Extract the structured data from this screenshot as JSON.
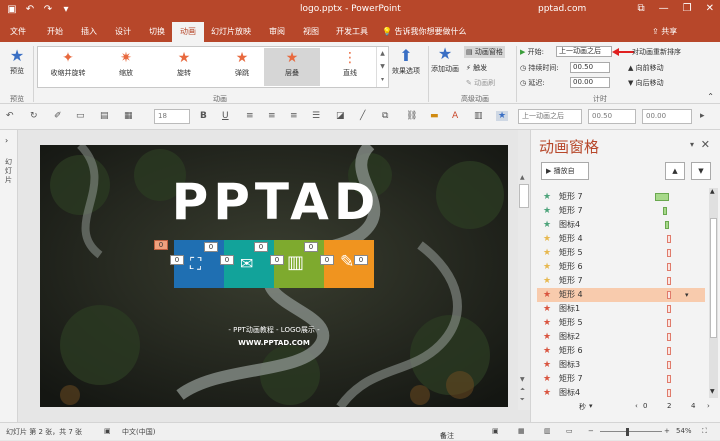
{
  "titlebar": {
    "doc_title": "logo.pptx  -  PowerPoint",
    "account": "pptad.com",
    "save_icon": "save-icon",
    "undo_icon": "undo-icon",
    "redo_icon": "redo-icon",
    "minimize": "—",
    "restore": "❐",
    "close": "✕",
    "ribbon_display": "⧉"
  },
  "tabs": [
    "文件",
    "开始",
    "插入",
    "设计",
    "切换",
    "动画",
    "幻灯片放映",
    "审阅",
    "视图",
    "开发工具"
  ],
  "active_tab": "动画",
  "tell_me": "告诉我你想要做什么",
  "share": "共享",
  "ribbon": {
    "preview": {
      "label": "预览",
      "group": "预览"
    },
    "gallery": [
      {
        "label": "收缩并旋转",
        "selected": false
      },
      {
        "label": "缩放",
        "selected": false
      },
      {
        "label": "旋转",
        "selected": false
      },
      {
        "label": "弹跳",
        "selected": false
      },
      {
        "label": "层叠",
        "selected": true
      },
      {
        "label": "直线",
        "selected": false
      }
    ],
    "effect_options": "效果选项",
    "animation_group": "动画",
    "add_animation": "添加动画",
    "animation_pane_btn": "动画窗格",
    "trigger": "触发",
    "painter": "动画刷",
    "advanced_group": "高级动画",
    "start_label": "开始:",
    "start_value": "上一动画之后",
    "duration_label": "持续时间:",
    "duration_value": "00.50",
    "delay_label": "延迟:",
    "delay_value": "00.00",
    "reorder": "对动画重新排序",
    "move_earlier": "向前移动",
    "move_later": "向后移动",
    "timing_group": "计时",
    "accent": "#b7472a"
  },
  "fmtbar": {
    "font_size": "18",
    "start_value": "上一动画之后",
    "duration_value": "00.50",
    "delay_value": "00.00"
  },
  "left_strip": "幻灯片",
  "slide": {
    "big_title": "PPTAD",
    "subtitle": "- PPT动画教程 - LOGO展示 -",
    "url": "WWW.PPTAD.COM",
    "badges": [
      "0",
      "0",
      "0",
      "0",
      "0",
      "0",
      "0",
      "0",
      "0"
    ],
    "tile_colors": [
      "#1f6fb2",
      "#12a39a",
      "#7eaa2e",
      "#f0941f"
    ]
  },
  "pane": {
    "title": "动画窗格",
    "play_label": "播放自",
    "rows": [
      {
        "name": "矩形 7",
        "color": "#4ca37a",
        "selected": false
      },
      {
        "name": "矩形 7",
        "color": "#4ca37a",
        "selected": false
      },
      {
        "name": "图标4",
        "color": "#4ca37a",
        "selected": false
      },
      {
        "name": "矩形 4",
        "color": "#e7b84f",
        "selected": false
      },
      {
        "name": "矩形 5",
        "color": "#e7b84f",
        "selected": false
      },
      {
        "name": "矩形 6",
        "color": "#e7b84f",
        "selected": false
      },
      {
        "name": "矩形 7",
        "color": "#e7b84f",
        "selected": false
      },
      {
        "name": "矩形 4",
        "color": "#d9543f",
        "selected": true
      },
      {
        "name": "图标1",
        "color": "#d9543f",
        "selected": false
      },
      {
        "name": "矩形 5",
        "color": "#d9543f",
        "selected": false
      },
      {
        "name": "图标2",
        "color": "#d9543f",
        "selected": false
      },
      {
        "name": "矩形 6",
        "color": "#d9543f",
        "selected": false
      },
      {
        "name": "图标3",
        "color": "#d9543f",
        "selected": false
      },
      {
        "name": "矩形 7",
        "color": "#d9543f",
        "selected": false
      },
      {
        "name": "图标4",
        "color": "#d9543f",
        "selected": false
      }
    ],
    "timeline_unit": "秒",
    "timeline_ticks": [
      "0",
      "2",
      "4"
    ]
  },
  "status": {
    "slide_info": "幻灯片 第 2 张，共 7 张",
    "language": "中文(中国)",
    "notes": "备注",
    "zoom": "54%"
  }
}
